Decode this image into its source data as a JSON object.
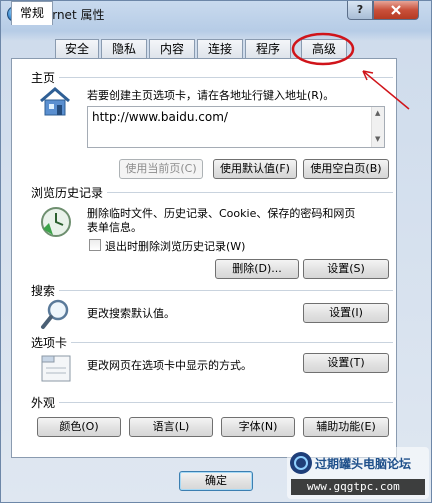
{
  "window": {
    "title": "Internet 属性",
    "help_label": "?",
    "close_label": "x"
  },
  "tabs": [
    {
      "label": "常规",
      "active": true
    },
    {
      "label": "安全"
    },
    {
      "label": "隐私"
    },
    {
      "label": "内容"
    },
    {
      "label": "连接"
    },
    {
      "label": "程序"
    },
    {
      "label": "高级"
    }
  ],
  "homepage": {
    "title": "主页",
    "description": "若要创建主页选项卡，请在各地址行键入地址(R)。",
    "url": "http://www.baidu.com/",
    "use_current": "使用当前页(C)",
    "use_default": "使用默认值(F)",
    "use_blank": "使用空白页(B)"
  },
  "history": {
    "title": "浏览历史记录",
    "description_line1": "删除临时文件、历史记录、Cookie、保存的密码和网页",
    "description_line2": "表单信息。",
    "checkbox_label": "退出时删除浏览历史记录(W)",
    "checked": false,
    "delete_button": "删除(D)...",
    "settings_button": "设置(S)"
  },
  "search": {
    "title": "搜索",
    "description": "更改搜索默认值。",
    "settings_button": "设置(I)"
  },
  "tabs_section": {
    "title": "选项卡",
    "description": "更改网页在选项卡中显示的方式。",
    "settings_button": "设置(T)"
  },
  "appearance": {
    "title": "外观",
    "colors_button": "颜色(O)",
    "languages_button": "语言(L)",
    "fonts_button": "字体(N)",
    "accessibility_button": "辅助功能(E)"
  },
  "footer": {
    "ok_button": "确定"
  },
  "watermark": {
    "line1": "过期罐头电脑论坛",
    "line2": "www.gqgtpc.com"
  },
  "colors": {
    "annotation": "#d0141a",
    "accent": "#3c7fb1"
  }
}
